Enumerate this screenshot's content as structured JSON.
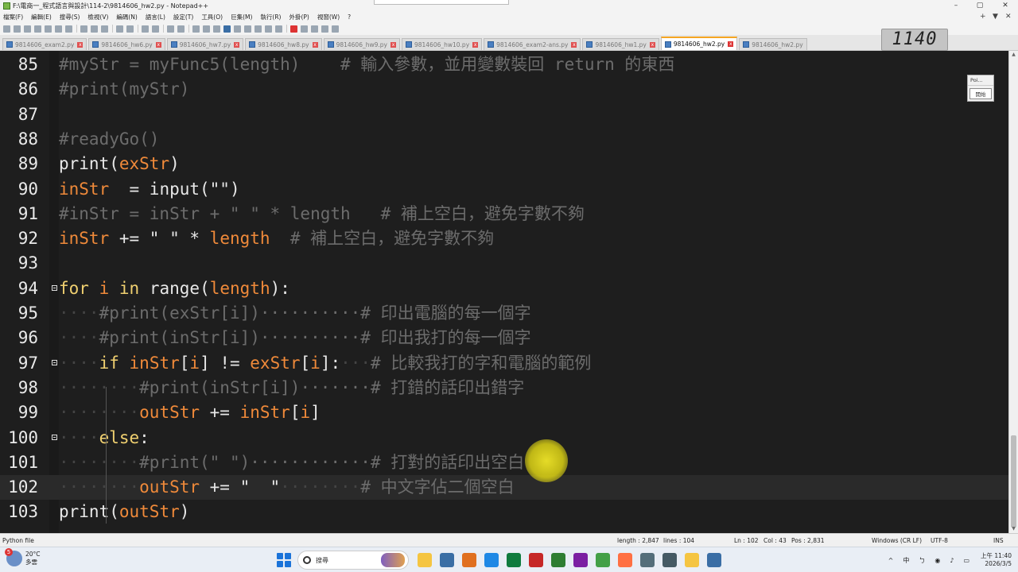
{
  "window": {
    "title": "F:\\電商一_程式語言與設計\\114-2\\9814606_hw2.py - Notepad++",
    "minimize": "–",
    "maximize": "▢",
    "close": "✕"
  },
  "menu": {
    "items": [
      "檔案(F)",
      "編輯(E)",
      "搜尋(S)",
      "檢視(V)",
      "編碼(N)",
      "語言(L)",
      "設定(T)",
      "工具(O)",
      "巨集(M)",
      "執行(R)",
      "外掛(P)",
      "視窗(W)",
      "?"
    ],
    "add_tab": "+",
    "dropdown": "▼",
    "close_doc": "✕"
  },
  "tabs": [
    {
      "label": "9814606_exam2.py",
      "active": false
    },
    {
      "label": "9814606_hw6.py",
      "active": false
    },
    {
      "label": "9814606_hw7.py",
      "active": false
    },
    {
      "label": "9814606_hw8.py",
      "active": false
    },
    {
      "label": "9814606_hw9.py",
      "active": false
    },
    {
      "label": "9814606_hw10.py",
      "active": false
    },
    {
      "label": "9814606_exam2-ans.py",
      "active": false
    },
    {
      "label": "9814606_hw1.py",
      "active": false
    },
    {
      "label": "9814606_hw2.py",
      "active": true
    },
    {
      "label": "9814606_hw2.py",
      "active": false
    }
  ],
  "tab_close_glyph": "x",
  "overlay_clock": "1140",
  "side_panel": {
    "title": "Poi...",
    "button": "開始"
  },
  "editor": {
    "current_line": 102,
    "lines": [
      {
        "n": "85",
        "fold": false,
        "tokens": [
          [
            "cmt",
            "#myStr = myFunc5(length)    # 輸入參數，並用變數裝回 return 的東西"
          ]
        ]
      },
      {
        "n": "86",
        "fold": false,
        "tokens": [
          [
            "cmt",
            "#print(myStr)"
          ]
        ]
      },
      {
        "n": "87",
        "fold": false,
        "tokens": []
      },
      {
        "n": "88",
        "fold": false,
        "tokens": [
          [
            "cmt",
            "#readyGo()"
          ]
        ]
      },
      {
        "n": "89",
        "fold": false,
        "tokens": [
          [
            "fn",
            "print"
          ],
          [
            "op",
            "("
          ],
          [
            "var",
            "exStr"
          ],
          [
            "op",
            ")"
          ]
        ]
      },
      {
        "n": "90",
        "fold": false,
        "tokens": [
          [
            "var",
            "inStr"
          ],
          [
            "op",
            "  = "
          ],
          [
            "fn",
            "input"
          ],
          [
            "op",
            "(\"\")"
          ]
        ]
      },
      {
        "n": "91",
        "fold": false,
        "tokens": [
          [
            "cmt",
            "#inStr = inStr + \" \" * length   # 補上空白，避免字數不夠"
          ]
        ]
      },
      {
        "n": "92",
        "fold": false,
        "tokens": [
          [
            "var",
            "inStr"
          ],
          [
            "op",
            " += "
          ],
          [
            "str",
            "\" \""
          ],
          [
            "op",
            " * "
          ],
          [
            "var",
            "length"
          ],
          [
            "cmt",
            "  # 補上空白，避免字數不夠"
          ]
        ]
      },
      {
        "n": "93",
        "fold": false,
        "tokens": []
      },
      {
        "n": "94",
        "fold": true,
        "tokens": [
          [
            "kw",
            "for"
          ],
          [
            "default",
            " "
          ],
          [
            "var",
            "i"
          ],
          [
            "default",
            " "
          ],
          [
            "kw",
            "in"
          ],
          [
            "default",
            " "
          ],
          [
            "fn",
            "range"
          ],
          [
            "op",
            "("
          ],
          [
            "var",
            "length"
          ],
          [
            "op",
            "):"
          ]
        ]
      },
      {
        "n": "95",
        "fold": false,
        "tokens": [
          [
            "ws",
            "····"
          ],
          [
            "cmt",
            "#print(exStr[i])··········# 印出電腦的每一個字"
          ]
        ]
      },
      {
        "n": "96",
        "fold": false,
        "tokens": [
          [
            "ws",
            "····"
          ],
          [
            "cmt",
            "#print(inStr[i])··········# 印出我打的每一個字"
          ]
        ]
      },
      {
        "n": "97",
        "fold": true,
        "tokens": [
          [
            "ws",
            "····"
          ],
          [
            "kw",
            "if"
          ],
          [
            "default",
            " "
          ],
          [
            "var",
            "inStr"
          ],
          [
            "op",
            "["
          ],
          [
            "var",
            "i"
          ],
          [
            "op",
            "] != "
          ],
          [
            "var",
            "exStr"
          ],
          [
            "op",
            "["
          ],
          [
            "var",
            "i"
          ],
          [
            "op",
            "]:"
          ],
          [
            "ws",
            "···"
          ],
          [
            "cmt",
            "# 比較我打的字和電腦的範例"
          ]
        ]
      },
      {
        "n": "98",
        "fold": false,
        "tokens": [
          [
            "ws",
            "········"
          ],
          [
            "cmt",
            "#print(inStr[i])·······# 打錯的話印出錯字"
          ]
        ]
      },
      {
        "n": "99",
        "fold": false,
        "tokens": [
          [
            "ws",
            "········"
          ],
          [
            "var",
            "outStr"
          ],
          [
            "op",
            " += "
          ],
          [
            "var",
            "inStr"
          ],
          [
            "op",
            "["
          ],
          [
            "var",
            "i"
          ],
          [
            "op",
            "]"
          ]
        ]
      },
      {
        "n": "100",
        "fold": true,
        "tokens": [
          [
            "ws",
            "····"
          ],
          [
            "kw",
            "else"
          ],
          [
            "op",
            ":"
          ]
        ]
      },
      {
        "n": "101",
        "fold": false,
        "tokens": [
          [
            "ws",
            "········"
          ],
          [
            "cmt",
            "#print(\" \")············# 打對的話印出空白"
          ]
        ]
      },
      {
        "n": "102",
        "fold": false,
        "tokens": [
          [
            "ws",
            "········"
          ],
          [
            "var",
            "outStr"
          ],
          [
            "op",
            " += "
          ],
          [
            "str",
            "\"  \""
          ],
          [
            "ws",
            "········"
          ],
          [
            "cmt",
            "# 中文字佔二個空白"
          ]
        ]
      },
      {
        "n": "103",
        "fold": false,
        "tokens": [
          [
            "fn",
            "print"
          ],
          [
            "op",
            "("
          ],
          [
            "var",
            "outStr"
          ],
          [
            "op",
            ")"
          ]
        ]
      }
    ]
  },
  "status": {
    "file_type": "Python file",
    "length": "length : 2,847",
    "lines": "lines : 104",
    "ln": "Ln : 102",
    "col": "Col : 43",
    "pos": "Pos : 2,831",
    "eol": "Windows (CR LF)",
    "encoding": "UTF-8",
    "mode": "INS"
  },
  "taskbar": {
    "weather_temp": "20°C",
    "weather_desc": "多雲",
    "weather_badge": "5",
    "search_placeholder": "搜尋",
    "tray_up": "^",
    "tray_ime": "中",
    "tray_ime2": "ㄅ",
    "clock_time": "上午 11:40",
    "clock_date": "2026/3/5",
    "app_colors": [
      "#f5c542",
      "#3a6ea5",
      "#e07020",
      "#1e88e5",
      "#0f7b3e",
      "#c62828",
      "#2e7d32",
      "#7b1fa2",
      "#43a047",
      "#ff7043",
      "#546e7a",
      "#455a64"
    ]
  }
}
